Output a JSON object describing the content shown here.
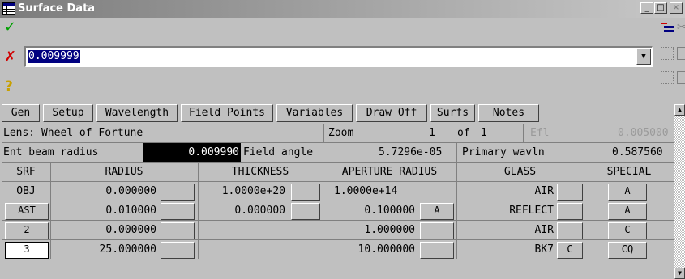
{
  "window": {
    "title": "Surface Data",
    "controls": [
      "_",
      "□",
      "×"
    ]
  },
  "toolbar": {
    "ok_glyph": "✓",
    "cancel_glyph": "✗",
    "help_glyph": "?",
    "input_value": "0.009999",
    "dropdown_glyph": "▼"
  },
  "tabs": [
    "Gen",
    "Setup",
    "Wavelength",
    "Field Points",
    "Variables",
    "Draw Off",
    "Surfs",
    "Notes"
  ],
  "info": {
    "lens_label": "Lens: Wheel of Fortune",
    "zoom_label": "Zoom",
    "zoom_value": "1",
    "of_label": "of",
    "of_value": "1",
    "efl_label": "Efl",
    "efl_value": "0.005000",
    "ent_label": "Ent beam radius",
    "ent_value": "0.009990",
    "field_label": "Field angle",
    "field_value": "5.7296e-05",
    "wavln_label": "Primary wavln",
    "wavln_value": "0.587560"
  },
  "table": {
    "headers": [
      "SRF",
      "RADIUS",
      "THICKNESS",
      "APERTURE RADIUS",
      "GLASS",
      "SPECIAL"
    ],
    "rows": [
      {
        "srf": "OBJ",
        "radius": "0.000000",
        "thickness": "1.0000e+20",
        "aperture": "1.0000e+14",
        "aperture_btn": "",
        "glass": "AIR",
        "glass_btn": "",
        "special": "A"
      },
      {
        "srf": "AST",
        "radius": "0.010000",
        "thickness": "0.000000",
        "aperture": "0.100000",
        "aperture_btn": "A",
        "glass": "REFLECT",
        "glass_btn": "",
        "special": "A"
      },
      {
        "srf": "2",
        "radius": "0.000000",
        "thickness": "",
        "aperture": "1.000000",
        "aperture_btn": "",
        "glass": "AIR",
        "glass_btn": "",
        "special": "C"
      },
      {
        "srf": "3",
        "radius": "25.000000",
        "thickness": "",
        "aperture": "10.000000",
        "aperture_btn": "",
        "glass": "BK7",
        "glass_btn": "C",
        "special": "CQ"
      }
    ]
  },
  "colors": {
    "title_start": "#7c7c7c",
    "title_end": "#c8c8c8",
    "selection": "#000080",
    "face": "#c0c0c0"
  }
}
